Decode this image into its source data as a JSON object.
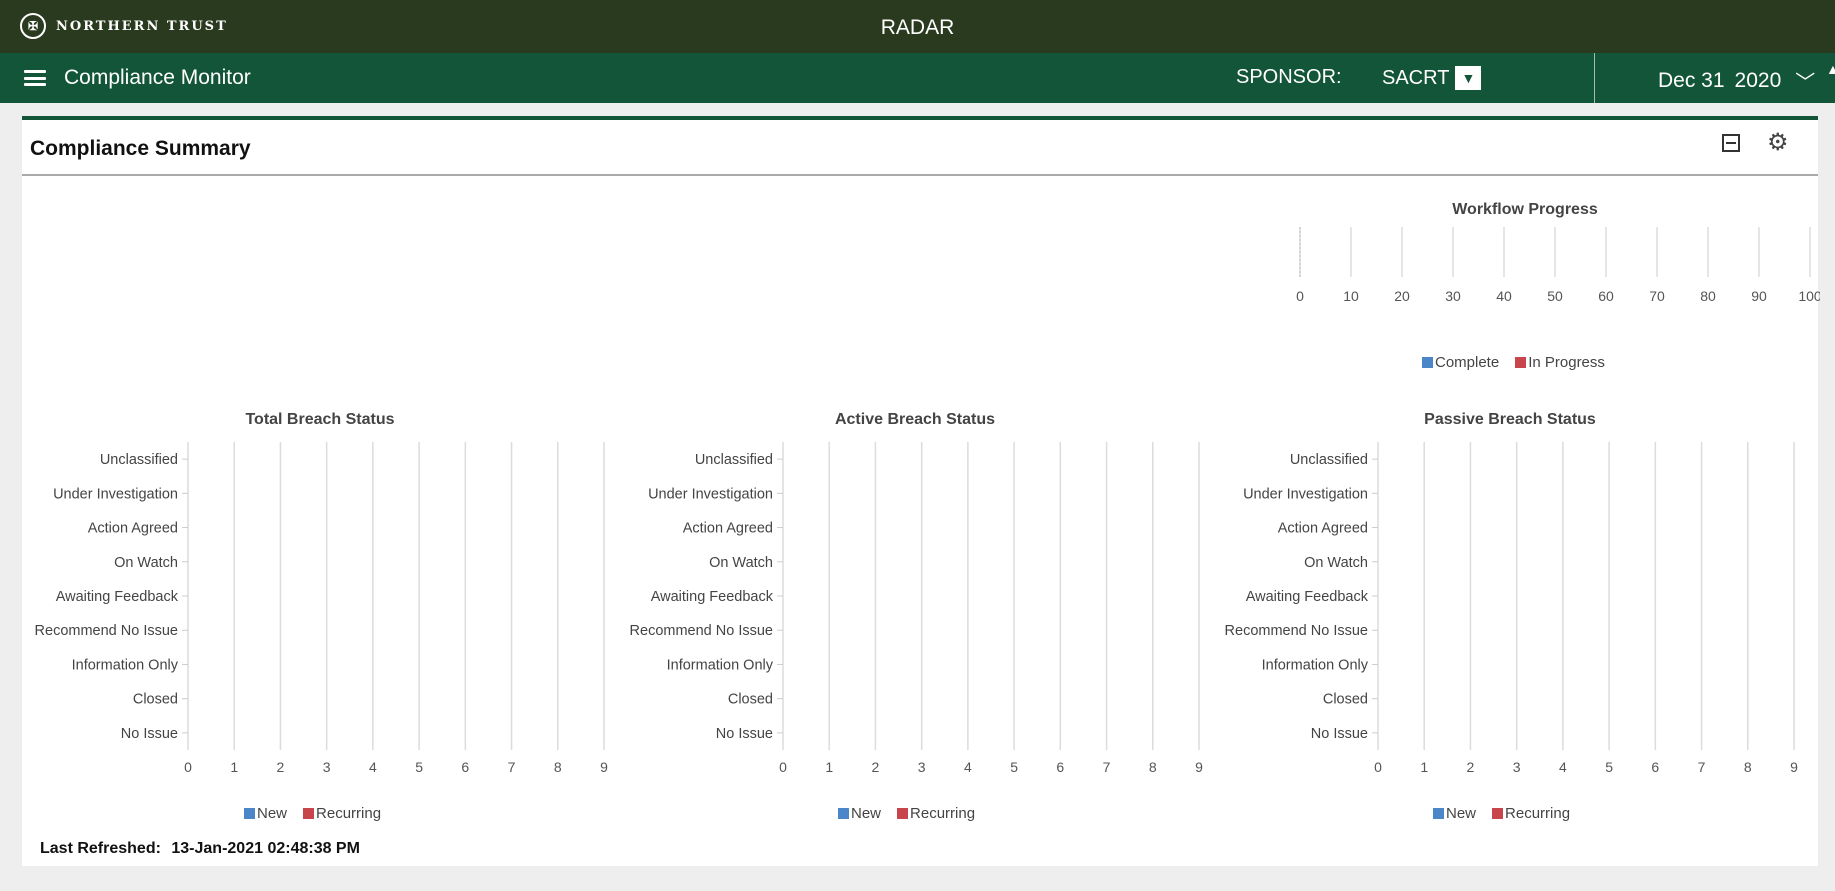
{
  "topbar": {
    "brand_name": "NORTHERN TRUST",
    "app_title": "RADAR"
  },
  "navbar": {
    "title": "Compliance Monitor",
    "sponsor_label": "SPONSOR:",
    "sponsor_value": "SACRT",
    "date_month_day": "Dec 31",
    "date_year": "2020"
  },
  "panel": {
    "title": "Compliance Summary"
  },
  "colors": {
    "new": "#4a86c8",
    "recurring": "#c8464b",
    "complete": "#4a86c8",
    "in_progress": "#c8464b"
  },
  "workflow": {
    "title": "Workflow Progress",
    "ticks": [
      "0",
      "10",
      "20",
      "30",
      "40",
      "50",
      "60",
      "70",
      "80",
      "90",
      "100"
    ],
    "legend": [
      "Complete",
      "In Progress"
    ]
  },
  "breach_charts": [
    {
      "title": "Total Breach Status",
      "categories": [
        "Unclassified",
        "Under Investigation",
        "Action Agreed",
        "On Watch",
        "Awaiting Feedback",
        "Recommend No Issue",
        "Information Only",
        "Closed",
        "No Issue"
      ],
      "ticks": [
        "0",
        "1",
        "2",
        "3",
        "4",
        "5",
        "6",
        "7",
        "8",
        "9"
      ],
      "legend": [
        "New",
        "Recurring"
      ]
    },
    {
      "title": "Active Breach Status",
      "categories": [
        "Unclassified",
        "Under Investigation",
        "Action Agreed",
        "On Watch",
        "Awaiting Feedback",
        "Recommend No Issue",
        "Information Only",
        "Closed",
        "No Issue"
      ],
      "ticks": [
        "0",
        "1",
        "2",
        "3",
        "4",
        "5",
        "6",
        "7",
        "8",
        "9"
      ],
      "legend": [
        "New",
        "Recurring"
      ]
    },
    {
      "title": "Passive Breach Status",
      "categories": [
        "Unclassified",
        "Under Investigation",
        "Action Agreed",
        "On Watch",
        "Awaiting Feedback",
        "Recommend No Issue",
        "Information Only",
        "Closed",
        "No Issue"
      ],
      "ticks": [
        "0",
        "1",
        "2",
        "3",
        "4",
        "5",
        "6",
        "7",
        "8",
        "9"
      ],
      "legend": [
        "New",
        "Recurring"
      ]
    }
  ],
  "chart_data": [
    {
      "type": "bar",
      "title": "Workflow Progress",
      "categories": [],
      "series": [
        {
          "name": "Complete",
          "values": []
        },
        {
          "name": "In Progress",
          "values": []
        }
      ],
      "xlim": [
        0,
        100
      ],
      "grid": true,
      "legend": "bottom"
    },
    {
      "type": "bar",
      "title": "Total Breach Status",
      "categories": [
        "Unclassified",
        "Under Investigation",
        "Action Agreed",
        "On Watch",
        "Awaiting Feedback",
        "Recommend No Issue",
        "Information Only",
        "Closed",
        "No Issue"
      ],
      "series": [
        {
          "name": "New",
          "values": [
            0,
            0,
            0,
            0,
            0,
            0,
            0,
            0,
            0
          ]
        },
        {
          "name": "Recurring",
          "values": [
            0,
            0,
            0,
            0,
            0,
            0,
            0,
            0,
            0
          ]
        }
      ],
      "xlim": [
        0,
        9
      ],
      "grid": true,
      "legend": "bottom"
    },
    {
      "type": "bar",
      "title": "Active Breach Status",
      "categories": [
        "Unclassified",
        "Under Investigation",
        "Action Agreed",
        "On Watch",
        "Awaiting Feedback",
        "Recommend No Issue",
        "Information Only",
        "Closed",
        "No Issue"
      ],
      "series": [
        {
          "name": "New",
          "values": [
            0,
            0,
            0,
            0,
            0,
            0,
            0,
            0,
            0
          ]
        },
        {
          "name": "Recurring",
          "values": [
            0,
            0,
            0,
            0,
            0,
            0,
            0,
            0,
            0
          ]
        }
      ],
      "xlim": [
        0,
        9
      ],
      "grid": true,
      "legend": "bottom"
    },
    {
      "type": "bar",
      "title": "Passive Breach Status",
      "categories": [
        "Unclassified",
        "Under Investigation",
        "Action Agreed",
        "On Watch",
        "Awaiting Feedback",
        "Recommend No Issue",
        "Information Only",
        "Closed",
        "No Issue"
      ],
      "series": [
        {
          "name": "New",
          "values": [
            0,
            0,
            0,
            0,
            0,
            0,
            0,
            0,
            0
          ]
        },
        {
          "name": "Recurring",
          "values": [
            0,
            0,
            0,
            0,
            0,
            0,
            0,
            0,
            0
          ]
        }
      ],
      "xlim": [
        0,
        9
      ],
      "grid": true,
      "legend": "bottom"
    }
  ],
  "footer": {
    "refreshed_label": "Last Refreshed:",
    "refreshed_value": "13-Jan-2021 02:48:38 PM"
  }
}
